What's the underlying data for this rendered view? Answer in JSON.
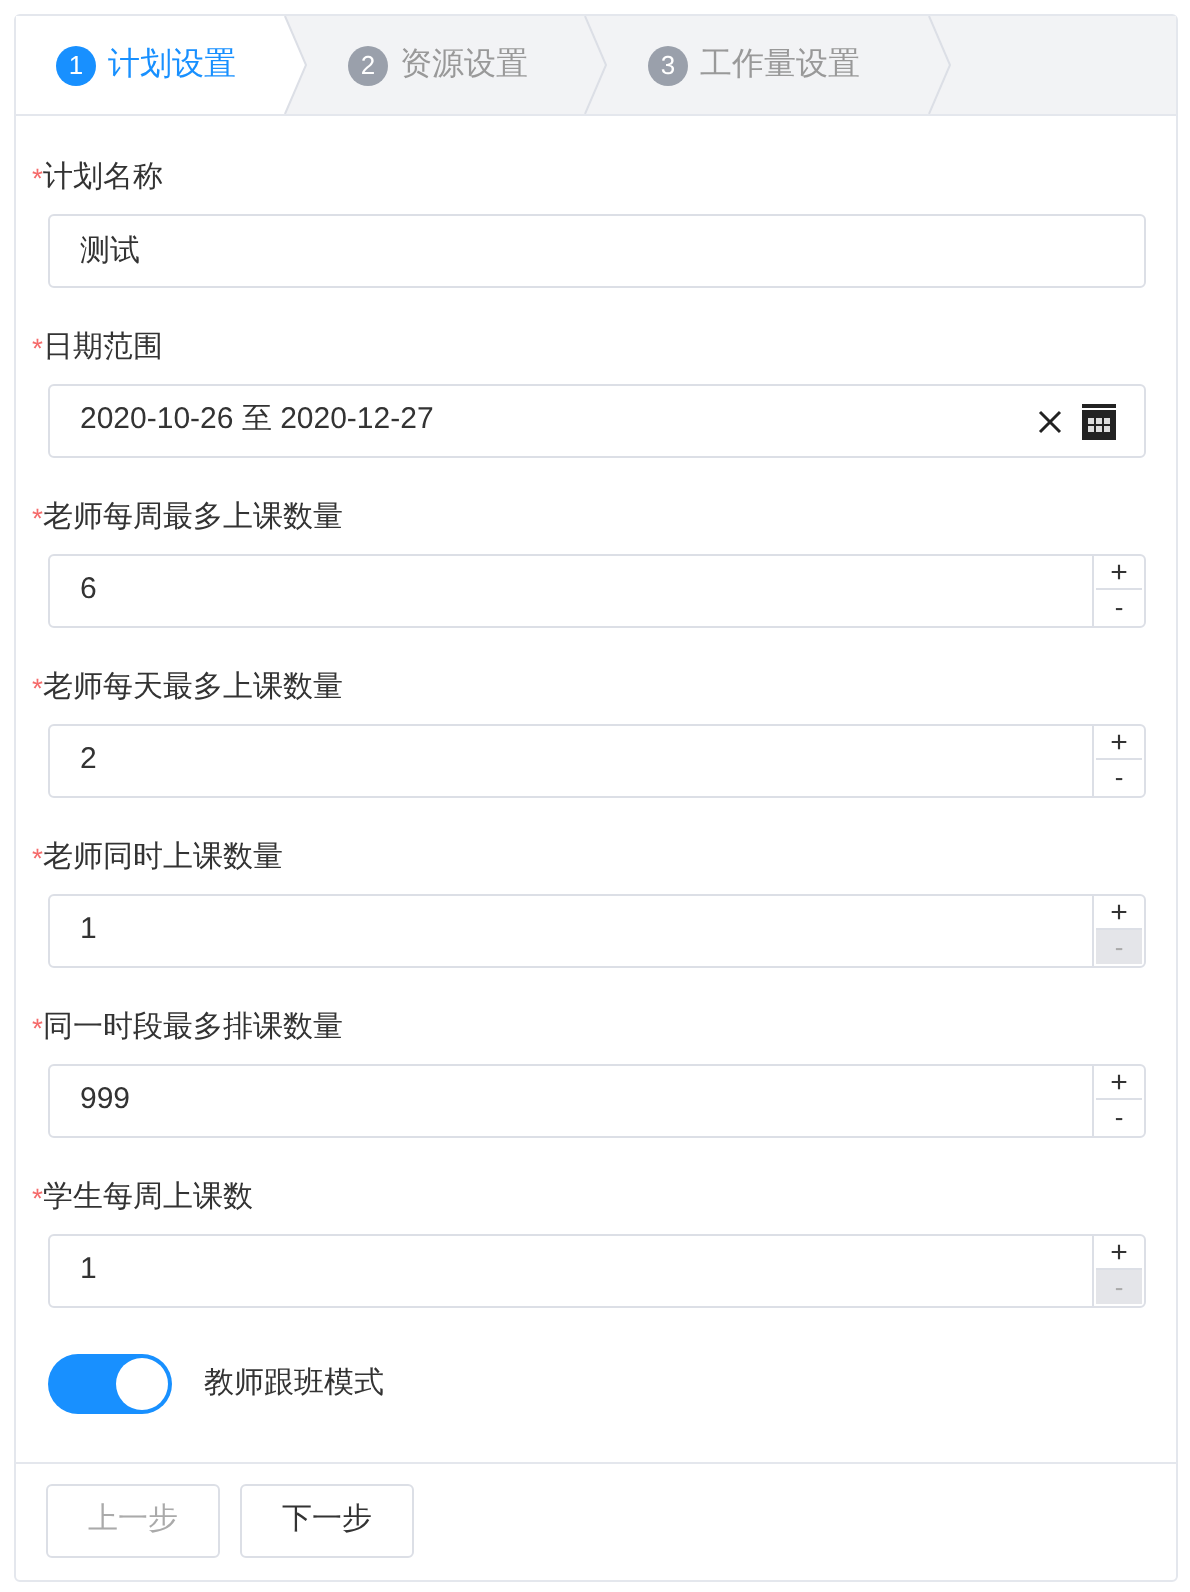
{
  "steps": [
    {
      "number": "1",
      "label": "计划设置",
      "selected": true
    },
    {
      "number": "2",
      "label": "资源设置",
      "selected": false
    },
    {
      "number": "3",
      "label": "工作量设置",
      "selected": false
    }
  ],
  "fields": [
    {
      "kind": "text",
      "label": "计划名称",
      "required": true,
      "value": "测试"
    },
    {
      "kind": "daterange",
      "label": "日期范围",
      "required": true,
      "value": "2020-10-26 至 2020-12-27"
    },
    {
      "kind": "number",
      "label": "老师每周最多上课数量",
      "required": true,
      "value": "6",
      "increment": "+",
      "decrement": "-",
      "decrement_disabled": false
    },
    {
      "kind": "number",
      "label": "老师每天最多上课数量",
      "required": true,
      "value": "2",
      "increment": "+",
      "decrement": "-",
      "decrement_disabled": false
    },
    {
      "kind": "number",
      "label": "老师同时上课数量",
      "required": true,
      "value": "1",
      "increment": "+",
      "decrement": "-",
      "decrement_disabled": true
    },
    {
      "kind": "number",
      "label": "同一时段最多排课数量",
      "required": true,
      "value": "999",
      "increment": "+",
      "decrement": "-",
      "decrement_disabled": false
    },
    {
      "kind": "number",
      "label": "学生每周上课数",
      "required": true,
      "value": "1",
      "increment": "+",
      "decrement": "-",
      "decrement_disabled": true
    }
  ],
  "required_mark": "*",
  "switch": {
    "label": "教师跟班模式",
    "on": true
  },
  "buttons": [
    {
      "label": "上一步",
      "disabled": true
    },
    {
      "label": "下一步",
      "disabled": false
    }
  ]
}
